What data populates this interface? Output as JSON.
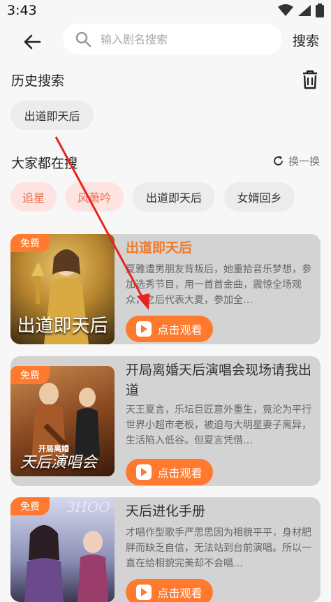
{
  "status": {
    "time": "3:43"
  },
  "search": {
    "placeholder": "输入剧名搜索",
    "button_label": "搜索"
  },
  "history": {
    "title": "历史搜索",
    "items": [
      "出道即天后"
    ]
  },
  "popular": {
    "title": "大家都在搜",
    "refresh_label": "换一换",
    "tags": [
      "追星",
      "风萧吟",
      "出道即天后",
      "女婿回乡"
    ]
  },
  "results": [
    {
      "badge": "免费",
      "title": "出道即天后",
      "poster_text": "出道即天后",
      "desc": "夏雅遭男朋友背叛后，她重拾音乐梦想，参加选秀节目，用一首首金曲，震惊全场观众，之后代表大夏，参加全…",
      "button": "点击观看"
    },
    {
      "badge": "免费",
      "title": "开局离婚天后演唱会现场请我出道",
      "poster_text_small": "开局离婚",
      "poster_text": "天后演唱会",
      "desc": "天王夏言，乐坛巨匠意外重生，竟沦为平行世界小超市老板，被迫与大明星妻子离异，生活陷入低谷。但夏言凭借…",
      "button": "点击观看"
    },
    {
      "badge": "免费",
      "title": "天后进化手册",
      "poster_text": "ЗНОО",
      "desc": "才唱作型歌手严思思因为相貌平平，身材肥胖而缺乏自信，无法站到台前演唱。所以一直在给相貌完美却不会唱…",
      "button": "点击观看"
    }
  ],
  "colors": {
    "accent": "#ff7a2e",
    "hot_chip_bg": "#fde4e1",
    "hot_chip_text": "#f06a4a",
    "annotation_arrow": "#e8231f"
  }
}
